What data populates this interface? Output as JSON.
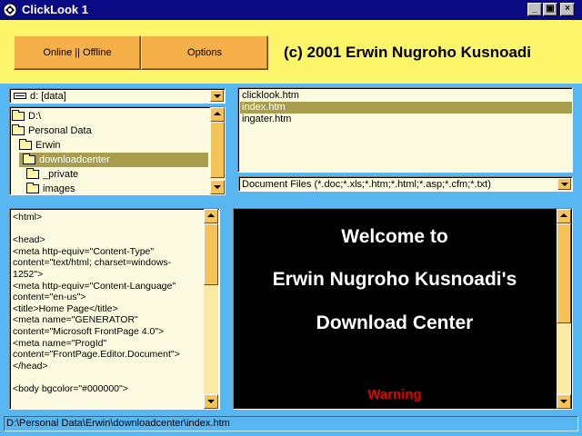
{
  "window": {
    "title": "ClickLook 1",
    "controls": {
      "minimize": "_",
      "restore": "▣",
      "close": "×"
    }
  },
  "header": {
    "online_button": "Online || Offline",
    "options_button": "Options",
    "copyright": "(c) 2001 Erwin Nugroho Kusnoadi"
  },
  "drive": {
    "value": "d: [data]"
  },
  "folders": [
    {
      "label": "D:\\"
    },
    {
      "label": "Personal Data"
    },
    {
      "label": "Erwin"
    },
    {
      "label": "downloadcenter",
      "selected": true
    },
    {
      "label": "_private"
    },
    {
      "label": "images"
    }
  ],
  "files": [
    {
      "label": "clicklook.htm"
    },
    {
      "label": "index.htm",
      "selected": true
    },
    {
      "label": "ingater.htm"
    }
  ],
  "filter": {
    "value": "Document Files (*.doc;*.xls;*.htm;*.html;*.asp;*.cfm;*.txt)"
  },
  "source": {
    "text": "<html>\n\n<head>\n<meta http-equiv=\"Content-Type\"\ncontent=\"text/html; charset=windows-\n1252\">\n<meta http-equiv=\"Content-Language\"\ncontent=\"en-us\">\n<title>Home Page</title>\n<meta name=\"GENERATOR\"\ncontent=\"Microsoft FrontPage 4.0\">\n<meta name=\"ProgId\"\ncontent=\"FrontPage.Editor.Document\">\n</head>\n\n<body bgcolor=\"#000000\">"
  },
  "preview": {
    "line1": "Welcome to",
    "line2": "Erwin Nugroho Kusnoadi's",
    "line3": "Download Center",
    "warning": "Warning"
  },
  "status": {
    "path": "D:\\Personal Data\\Erwin\\downloadcenter\\index.htm"
  },
  "colors": {
    "titlebar": "#0a0a84",
    "header_bg": "#fdf56a",
    "window_bg": "#58b7f0",
    "panel_bg": "#fdfbdf",
    "button_bg": "#f6b04a",
    "selection": "#a89e4e",
    "preview_bg": "#000000",
    "warning": "#e60000"
  },
  "icons": [
    "app-icon",
    "drive-icon",
    "folder-icon",
    "chevron-down-icon",
    "chevron-up-icon"
  ]
}
